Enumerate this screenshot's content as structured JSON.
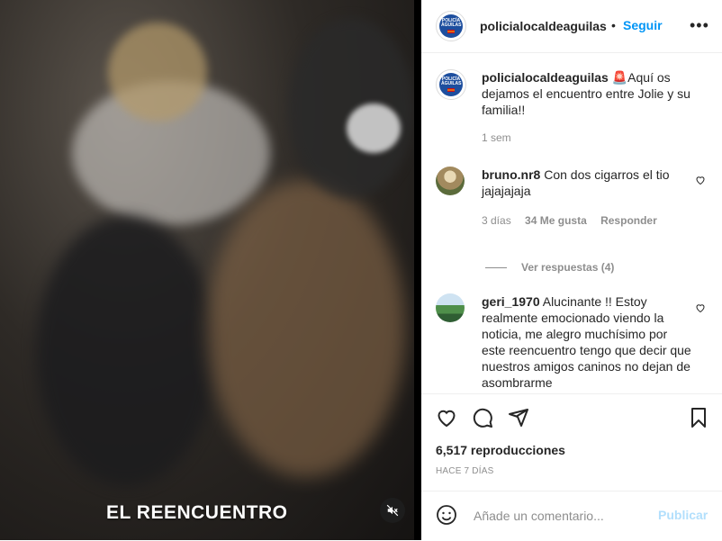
{
  "video": {
    "caption": "EL REENCUENTRO",
    "mute_icon": "speaker-muted-icon"
  },
  "header": {
    "username": "policialocaldeaguilas",
    "separator": "•",
    "follow_label": "Seguir",
    "more_label": "•••",
    "avatar_text": "POLICÍA ÁGUILAS"
  },
  "caption_post": {
    "username": "policialocaldeaguilas",
    "emoji": "🚨",
    "text": "Aquí os dejamos el encuentro entre Jolie y su familia!!",
    "time": "1 sem"
  },
  "comments": [
    {
      "username": "bruno.nr8",
      "text": "Con dos cigarros el tio jajajajaja",
      "time": "3 días",
      "likes": "34 Me gusta",
      "reply": "Responder",
      "view_replies": "Ver respuestas (4)"
    },
    {
      "username": "geri_1970",
      "text": "Alucinante !! Estoy realmente emocionado viendo la noticia, me alegro muchísimo por este reencuentro tengo que decir que nuestros amigos caninos no dejan de asombrarme"
    }
  ],
  "stats": {
    "views": "6,517 reproducciones",
    "ago": "HACE 7 DÍAS"
  },
  "add_comment": {
    "placeholder": "Añade un comentario...",
    "publish_label": "Publicar"
  },
  "colors": {
    "accent": "#0095f6",
    "publish_disabled": "#b2dffc",
    "muted_text": "#8e8e8e",
    "police_blue": "#1d4e9e"
  }
}
